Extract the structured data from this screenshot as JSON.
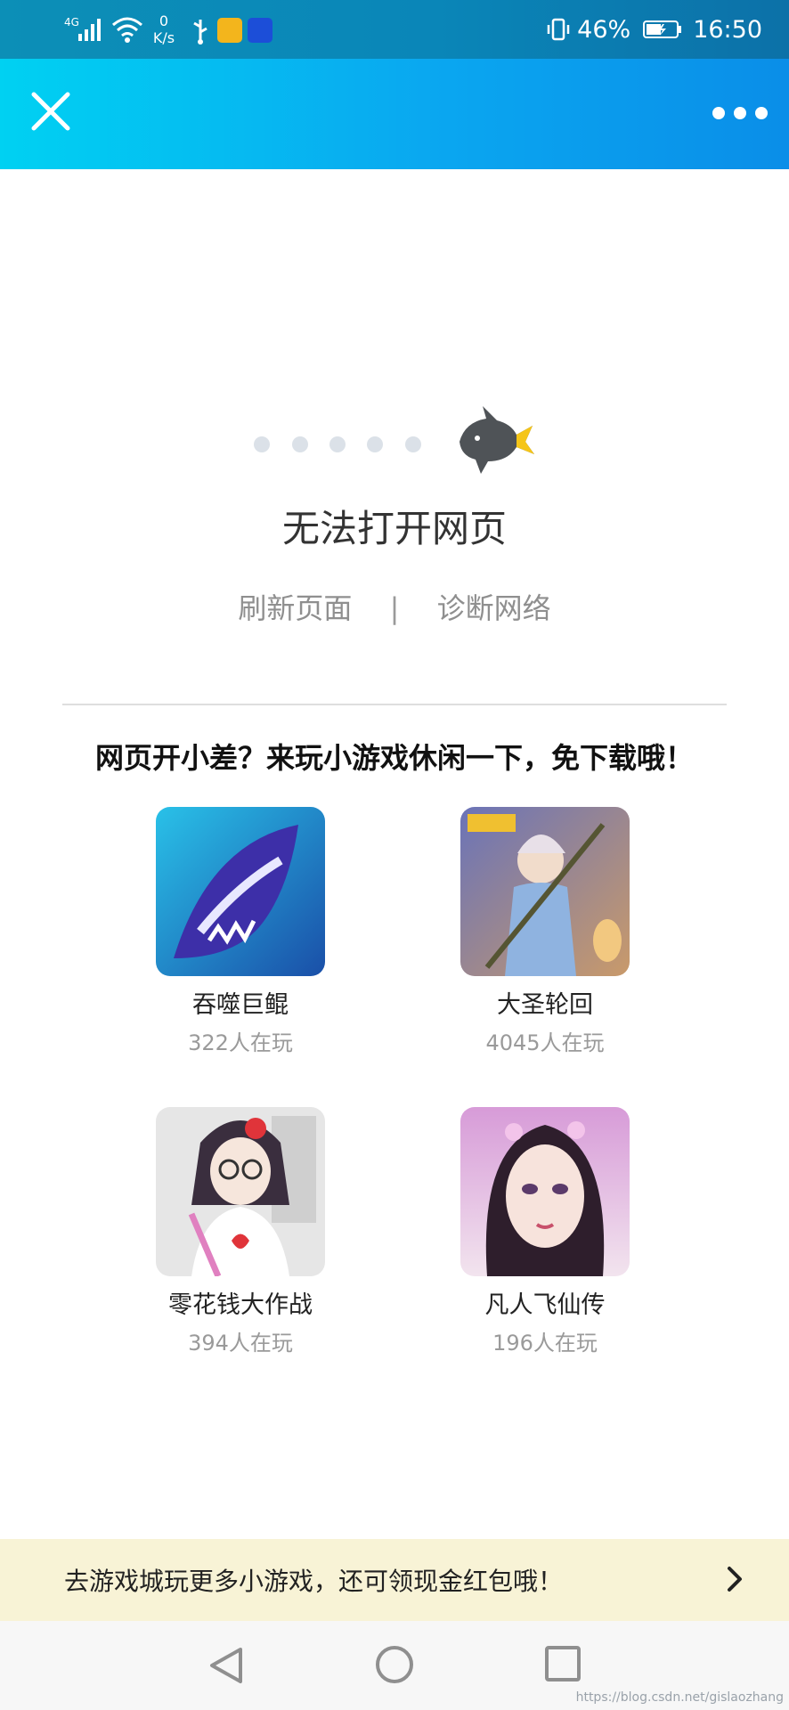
{
  "status_bar": {
    "network_type": "4G",
    "net_speed_value": "0",
    "net_speed_unit": "K/s",
    "battery_percent": "46%",
    "time": "16:50"
  },
  "header": {
    "close_icon": "close-icon",
    "more_icon": "more-options-icon"
  },
  "error": {
    "title": "无法打开网页",
    "refresh_label": "刷新页面",
    "separator": "|",
    "diagnose_label": "诊断网络"
  },
  "promo": {
    "title": "网页开小差？来玩小游戏休闲一下，免下载哦！"
  },
  "games": [
    {
      "name": "吞噬巨鲲",
      "players": "322人在玩"
    },
    {
      "name": "大圣轮回",
      "players": "4045人在玩"
    },
    {
      "name": "零花钱大作战",
      "players": "394人在玩"
    },
    {
      "name": "凡人飞仙传",
      "players": "196人在玩"
    }
  ],
  "bottom_banner": {
    "text": "去游戏城玩更多小游戏，还可领现金红包哦！"
  },
  "watermark": "https://blog.csdn.net/gislaozhang",
  "colors": {
    "header_start": "#00d1f2",
    "header_end": "#0a8ee8",
    "banner_bg": "#f8f3d6"
  }
}
